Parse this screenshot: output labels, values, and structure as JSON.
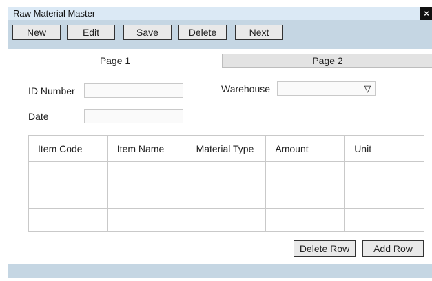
{
  "window": {
    "title": "Raw Material Master",
    "close_label": "×"
  },
  "toolbar": {
    "new": "New",
    "edit": "Edit",
    "save": "Save",
    "delete": "Delete",
    "next": "Next"
  },
  "tabs": [
    {
      "label": "Page 1"
    },
    {
      "label": "Page 2"
    }
  ],
  "form": {
    "id_number": {
      "label": "ID Number",
      "value": ""
    },
    "date": {
      "label": "Date",
      "value": ""
    },
    "warehouse": {
      "label": "Warehouse",
      "value": "",
      "arrow": "▽"
    }
  },
  "table": {
    "headers": [
      "Item Code",
      "Item Name",
      "Material Type",
      "Amount",
      "Unit"
    ],
    "rows": [
      [
        "",
        "",
        "",
        "",
        ""
      ],
      [
        "",
        "",
        "",
        "",
        ""
      ],
      [
        "",
        "",
        "",
        "",
        ""
      ]
    ]
  },
  "actions": {
    "delete_row": "Delete Row",
    "add_row": "Add Row"
  }
}
